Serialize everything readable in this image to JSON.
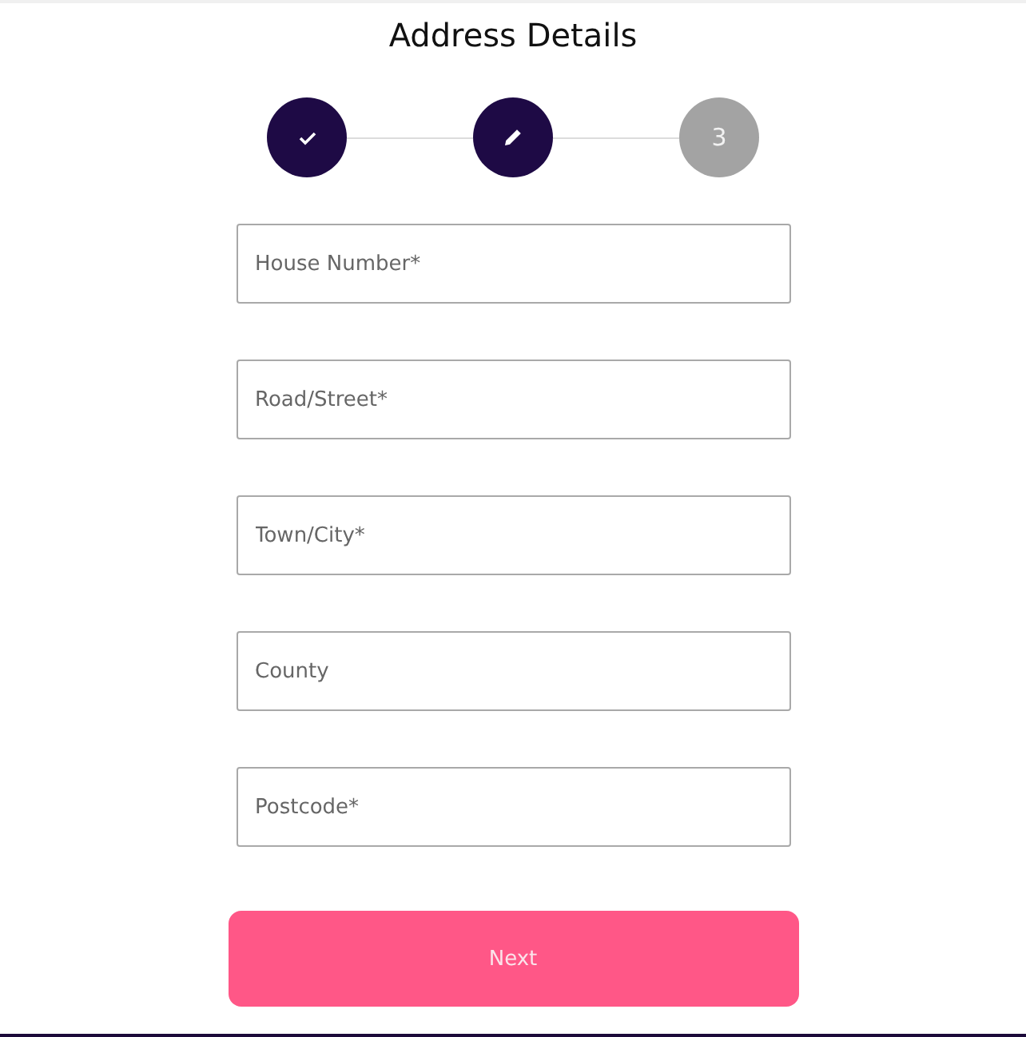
{
  "title": "Address Details",
  "steps": [
    {
      "kind": "done"
    },
    {
      "kind": "current"
    },
    {
      "kind": "pending",
      "label": "3"
    }
  ],
  "fields": [
    {
      "placeholder": "House Number*"
    },
    {
      "placeholder": "Road/Street*"
    },
    {
      "placeholder": "Town/City*"
    },
    {
      "placeholder": "County"
    },
    {
      "placeholder": "Postcode*"
    }
  ],
  "button": "Next"
}
